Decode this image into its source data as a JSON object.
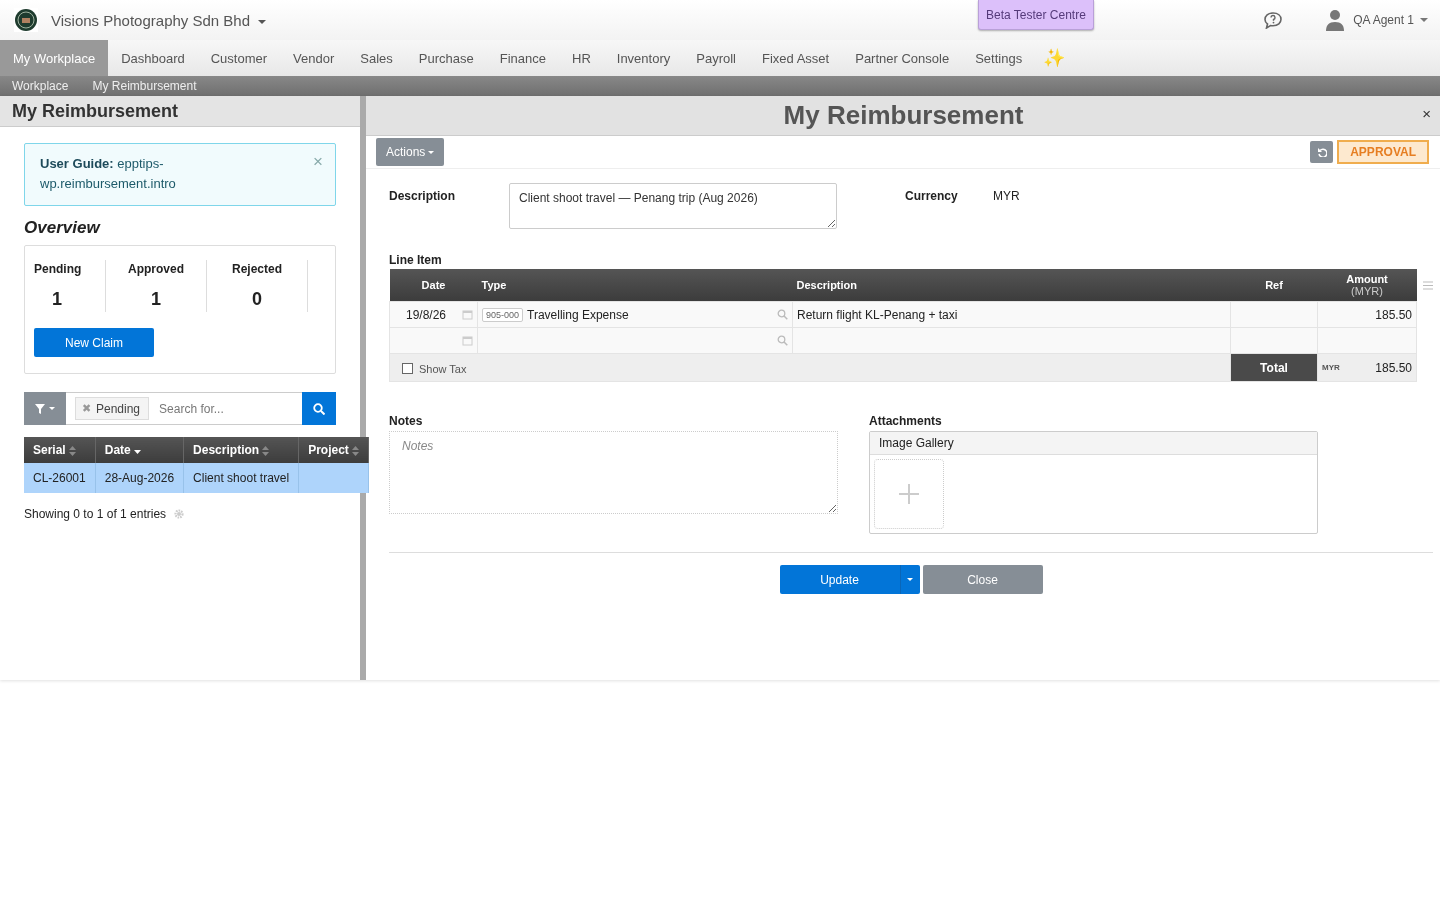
{
  "header": {
    "company": "Visions Photography Sdn Bhd",
    "beta_button": "Beta Tester Centre",
    "user": "QA Agent 1"
  },
  "nav": [
    {
      "label": "My Workplace",
      "selected": true
    },
    {
      "label": "Dashboard",
      "selected": false
    },
    {
      "label": "Customer",
      "selected": false
    },
    {
      "label": "Vendor",
      "selected": false
    },
    {
      "label": "Sales",
      "selected": false
    },
    {
      "label": "Purchase",
      "selected": false
    },
    {
      "label": "Finance",
      "selected": false
    },
    {
      "label": "HR",
      "selected": false
    },
    {
      "label": "Inventory",
      "selected": false
    },
    {
      "label": "Payroll",
      "selected": false
    },
    {
      "label": "Fixed Asset",
      "selected": false
    },
    {
      "label": "Partner Console",
      "selected": false
    },
    {
      "label": "Settings",
      "selected": false
    },
    {
      "label": "✨",
      "selected": false
    }
  ],
  "breadcrumb": [
    "Workplace",
    "My Reimbursement"
  ],
  "left": {
    "title": "My Reimbursement",
    "guide": "**User Guide:** epptips-wp.reimbursement.intro",
    "guide_close": "×",
    "overview_title": "Overview",
    "stats": [
      {
        "label": "Pending",
        "value": "1"
      },
      {
        "label": "Approved",
        "value": "1"
      },
      {
        "label": "Rejected",
        "value": "0"
      }
    ],
    "new_claim": "New Claim",
    "filter_tag_remove": "✖",
    "filter_tag": "Pending",
    "search_placeholder": "Search for...",
    "columns": [
      {
        "label": "Serial",
        "sorted": false
      },
      {
        "label": "Date",
        "sorted": true
      },
      {
        "label": "Description",
        "sorted": false
      },
      {
        "label": "Project",
        "sorted": false
      }
    ],
    "rows": [
      {
        "selected": true,
        "cells": [
          "CL-26001",
          "28-Aug-2026",
          "Client shoot travel",
          ""
        ]
      }
    ],
    "footer": "Showing 0 to 1 of 1 entries"
  },
  "form": {
    "title": "My Reimbursement",
    "close": "×",
    "actions": "Actions",
    "status": "APPROVAL",
    "description_label": "Description",
    "description_value": "Client shoot travel — Penang trip (Aug 2026)",
    "currency_label": "Currency",
    "currency_value": "MYR",
    "line_item_label": "Line Item",
    "line_columns": [
      {
        "label": "Date"
      },
      {
        "label": "Type"
      },
      {
        "label": "Description"
      },
      {
        "label": "Ref"
      },
      {
        "label": "Amount",
        "sub": "(MYR)"
      }
    ],
    "lines": [
      {
        "date": "19/8/26",
        "type_code": "905-000",
        "type": "Travelling Expense",
        "description": "Return flight KL-Penang + taxi",
        "amount": "185.50"
      }
    ],
    "show_tax": {
      "label": "Show Tax",
      "checked": false
    },
    "total_label": "Total",
    "total_currency": "MYR",
    "total": "185.50",
    "notes_label": "Notes",
    "notes_placeholder": "Notes",
    "attachments_label": "Attachments",
    "gallery_label": "Image Gallery",
    "buttons": {
      "update": "Update",
      "close": "Close"
    }
  }
}
